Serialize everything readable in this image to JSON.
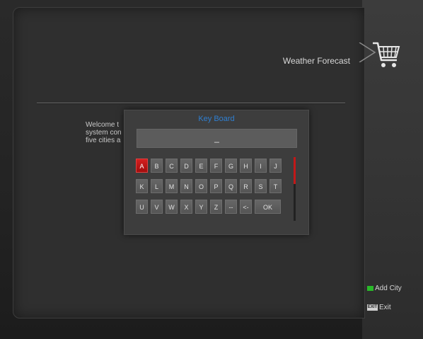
{
  "header": {
    "title": "Weather Forecast"
  },
  "welcome": {
    "text": "Welcome t\nsystem con\nfive cities a"
  },
  "keyboard": {
    "title": "Key Board",
    "input_value": "_",
    "rows": [
      [
        "A",
        "B",
        "C",
        "D",
        "E",
        "F",
        "G",
        "H",
        "I",
        "J"
      ],
      [
        "K",
        "L",
        "M",
        "N",
        "O",
        "P",
        "Q",
        "R",
        "S",
        "T"
      ],
      [
        "U",
        "V",
        "W",
        "X",
        "Y",
        "Z",
        "--",
        "<-",
        "OK"
      ]
    ],
    "selected_key": "A"
  },
  "legend": {
    "add_city": "Add City",
    "exit": "Exit",
    "exit_key": "EXIT"
  },
  "icons": {
    "cart": "shopping-cart-icon"
  },
  "colors": {
    "accent_red": "#c21818",
    "title_blue": "#2f7fd1",
    "green_key": "#29b929"
  }
}
